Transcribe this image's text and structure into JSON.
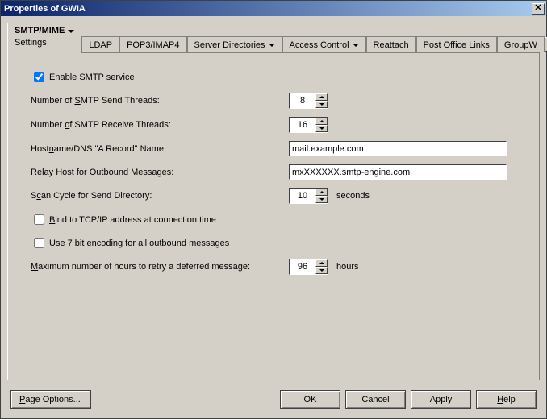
{
  "window": {
    "title": "Properties of GWIA"
  },
  "tabs": {
    "active": {
      "label": "SMTP/MIME",
      "sub": "Settings"
    },
    "items": [
      "LDAP",
      "POP3/IMAP4",
      "Server Directories",
      "Access Control",
      "Reattach",
      "Post Office Links",
      "GroupW"
    ]
  },
  "form": {
    "enable_smtp": {
      "label_pre": "E",
      "label_rest": "nable SMTP service",
      "checked": true
    },
    "send_threads": {
      "label_pre": "Number of ",
      "u": "S",
      "label_rest": "MTP Send Threads:",
      "value": "8"
    },
    "recv_threads": {
      "label_pre": "Number ",
      "u": "o",
      "label_rest": "f SMTP Receive Threads:",
      "value": "16"
    },
    "hostname": {
      "label_pre": "Host",
      "u": "n",
      "label_rest": "ame/DNS \"A Record\" Name:",
      "value": "mail.example.com"
    },
    "relay": {
      "label_pre": "",
      "u": "R",
      "label_rest": "elay Host for Outbound Messages:",
      "value": "mxXXXXXX.smtp-engine.com"
    },
    "scan": {
      "label_pre": "S",
      "u": "c",
      "label_rest": "an Cycle for Send Directory:",
      "value": "10",
      "suffix": "seconds"
    },
    "bind": {
      "label_pre": "",
      "u": "B",
      "label_rest": "ind to TCP/IP address at connection time",
      "checked": false
    },
    "seven": {
      "label_pre": "Use ",
      "u": "7",
      "label_rest": " bit encoding for all outbound messages",
      "checked": false
    },
    "retry": {
      "label_pre": "",
      "u": "M",
      "label_rest": "aximum number of hours to retry a deferred message:",
      "value": "96",
      "suffix": "hours"
    }
  },
  "buttons": {
    "page_options": "Page Options...",
    "ok": "OK",
    "cancel": "Cancel",
    "apply": "Apply",
    "help": "Help"
  }
}
